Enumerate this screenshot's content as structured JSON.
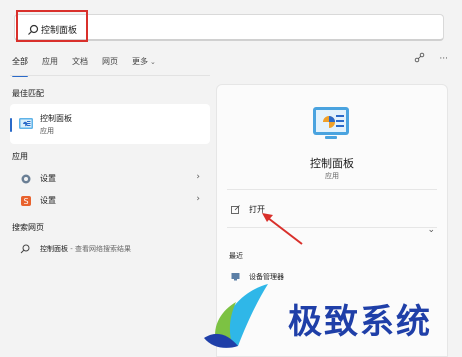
{
  "search": {
    "value": "控制面板"
  },
  "tabs": [
    {
      "label": "全部"
    },
    {
      "label": "应用"
    },
    {
      "label": "文档"
    },
    {
      "label": "网页"
    },
    {
      "label": "更多"
    }
  ],
  "sections": {
    "best_match": "最佳匹配",
    "apps": "应用",
    "web": "搜索网页"
  },
  "best": {
    "title": "控制面板",
    "subtitle": "应用"
  },
  "app_rows": [
    {
      "label": "设置"
    },
    {
      "label": "设置"
    }
  ],
  "web_row": {
    "query": "控制面板",
    "suffix": " - 查看网络搜索结果"
  },
  "panel": {
    "title": "控制面板",
    "subtitle": "应用",
    "open_label": "打开",
    "recent_label": "最近",
    "recent_items": [
      {
        "label": "设备管理器"
      }
    ]
  },
  "watermark": {
    "text": "极致系统"
  },
  "colors": {
    "accent": "#2a6ac9",
    "highlight": "#d9302b",
    "watermark": "#1f3fa8"
  }
}
